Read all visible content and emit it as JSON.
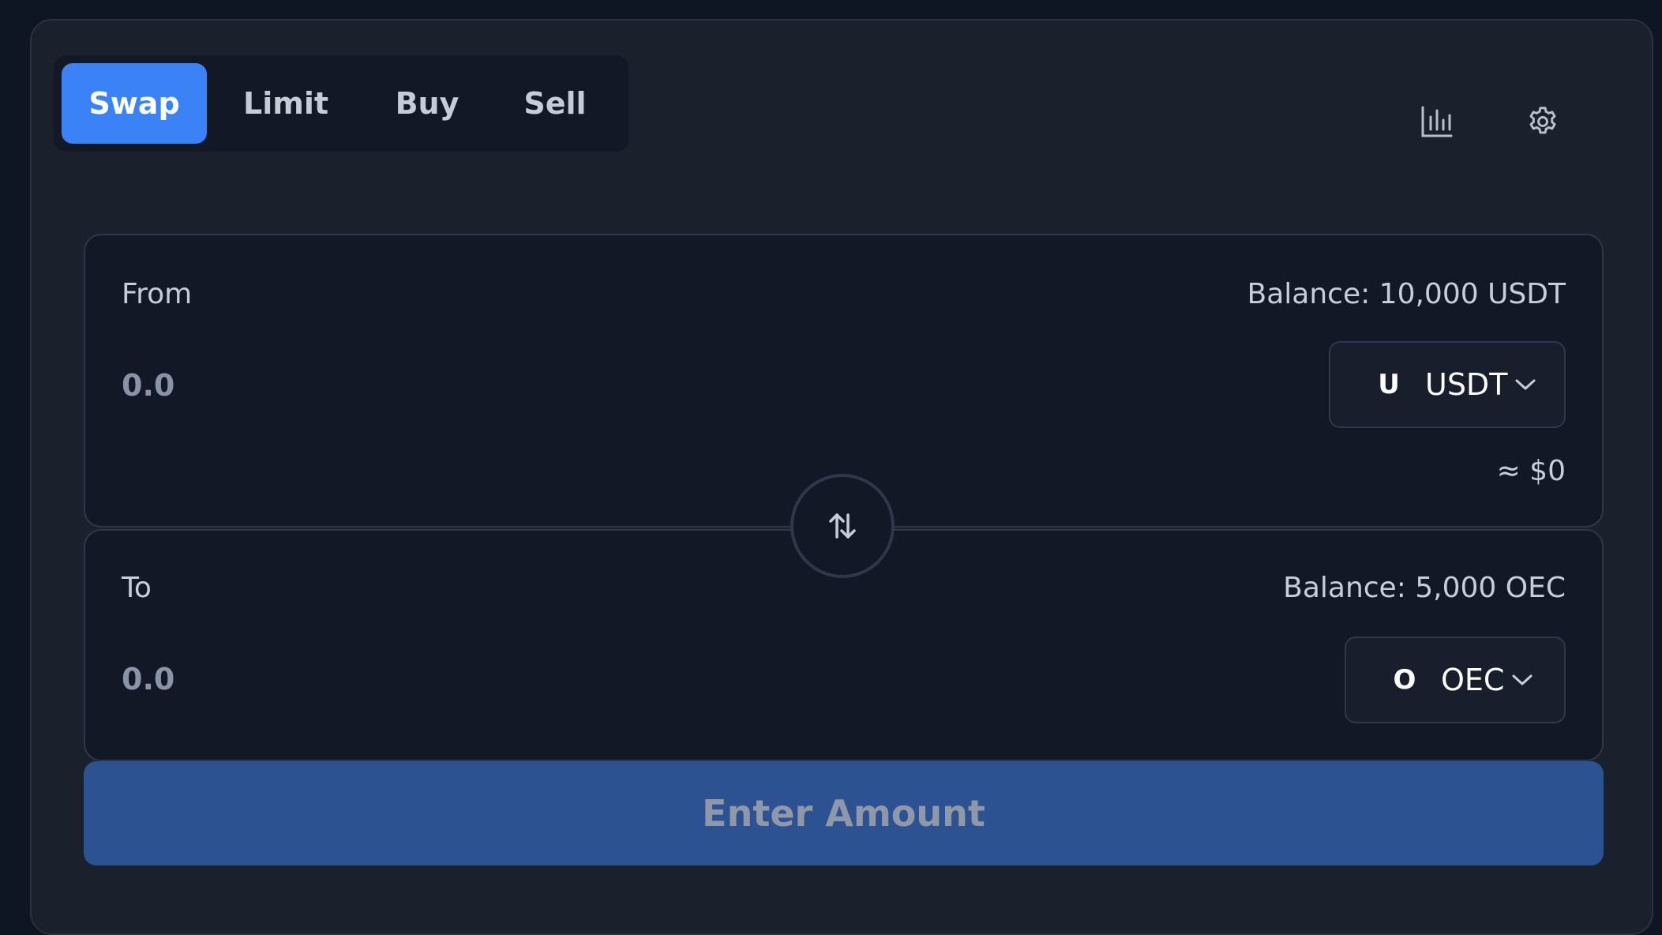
{
  "tabs": [
    {
      "label": "Swap",
      "active": true
    },
    {
      "label": "Limit",
      "active": false
    },
    {
      "label": "Buy",
      "active": false
    },
    {
      "label": "Sell",
      "active": false
    }
  ],
  "toolbar": {
    "chart_icon": "bar-chart-icon",
    "settings_icon": "gear-icon"
  },
  "from": {
    "label": "From",
    "balance": "Balance: 10,000 USDT",
    "amount_placeholder": "0.0",
    "token_glyph": "U",
    "token_symbol": "USDT",
    "usd_value": "≈ $0"
  },
  "to": {
    "label": "To",
    "balance": "Balance: 5,000 OEC",
    "amount_placeholder": "0.0",
    "token_glyph": "O",
    "token_symbol": "OEC"
  },
  "swap_direction_icon": "swap-vertical-arrows-icon",
  "submit": {
    "label": "Enter Amount"
  },
  "colors": {
    "accent": "#3b82f6",
    "button_disabled": "#2c5291",
    "background": "#1a202c",
    "panel": "#121826"
  }
}
